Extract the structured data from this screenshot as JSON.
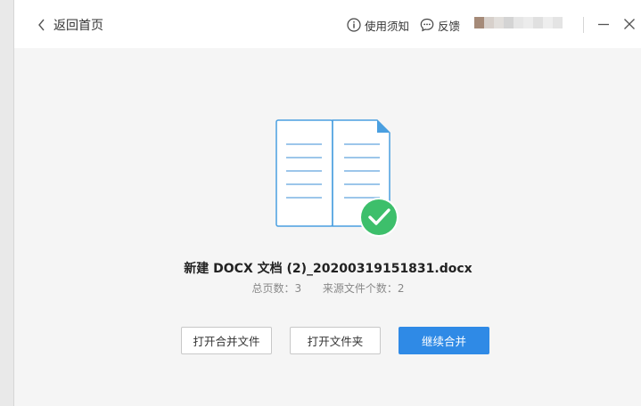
{
  "titlebar": {
    "back_label": "返回首页",
    "notice_label": "使用须知",
    "feedback_label": "反馈",
    "user_avatar_colors": [
      "#a58a78",
      "#d7d0cb",
      "#e2dfdc",
      "#d4d4d4",
      "#e6e6e6",
      "#ececec",
      "#e0e0e0",
      "#eeeeee",
      "#e4e4e4"
    ]
  },
  "result": {
    "file_name": "新建 DOCX 文档 (2)_20200319151831.docx",
    "total_pages": "总页数：3",
    "source_files": "来源文件个数：2"
  },
  "actions": {
    "open_merged": "打开合并文件",
    "open_folder": "打开文件夹",
    "continue_merge": "继续合并"
  },
  "colors": {
    "accent": "#2f8ae6",
    "success": "#3dbf6b",
    "doc_blue": "#4a9fe0"
  },
  "icons": [
    "chevron-left-icon",
    "info-icon",
    "chat-icon",
    "minimize-icon",
    "close-icon",
    "document-icon",
    "check-icon"
  ]
}
